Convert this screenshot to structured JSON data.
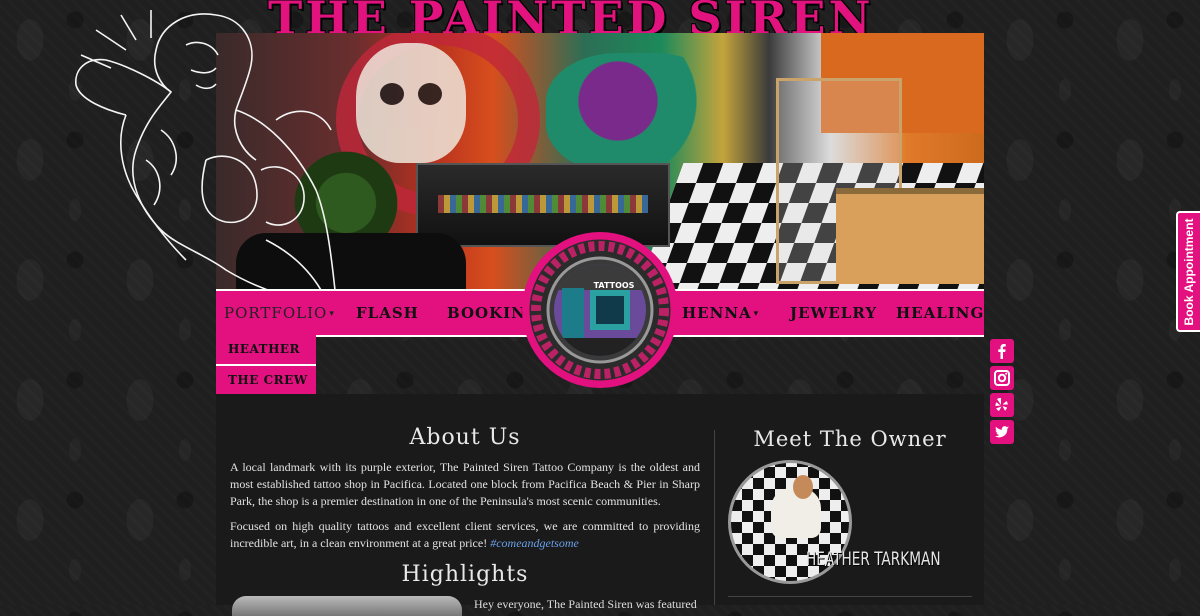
{
  "site": {
    "title": "THE PAINTED SIREN"
  },
  "colors": {
    "accent": "#e3107f",
    "background": "#1f1f20",
    "panel": "#1a1a1b",
    "link": "#6aa0e8"
  },
  "nav": {
    "items": [
      {
        "label": "PORTFOLIO",
        "has_caret": true
      },
      {
        "label": "FLASH",
        "has_caret": false
      },
      {
        "label": "BOOKING",
        "has_caret": true
      },
      {
        "label": "HENNA",
        "has_caret": true
      },
      {
        "label": "JEWELRY",
        "has_caret": false
      },
      {
        "label": "HEALING",
        "has_caret": false
      }
    ],
    "caret": "▾",
    "dropdown": [
      "HEATHER",
      "THE CREW"
    ]
  },
  "medallion": {
    "storefront_sign": "TATTOOS"
  },
  "about": {
    "title": "About Us",
    "para1": "A local landmark with its purple exterior, The Painted Siren Tattoo Company is the oldest and most established tattoo shop in Pacifica. Located one block from Pacifica Beach & Pier in Sharp Park, the shop is a premier destination in one of the Peninsula's most scenic communities.",
    "para2": "Focused on high quality tattoos and excellent client services, we are committed to providing incredible art, in a clean environment at a great price! ",
    "hashtag": "#comeandgetsome"
  },
  "highlights": {
    "title": "Highlights",
    "text": "Hey everyone, The Painted Siren was featured"
  },
  "owner": {
    "title": "Meet The Owner",
    "name": "HEATHER TARKMAN"
  },
  "social": [
    "facebook-icon",
    "instagram-icon",
    "yelp-icon",
    "twitter-icon"
  ],
  "book_tab": {
    "label": "Book Appointment"
  }
}
